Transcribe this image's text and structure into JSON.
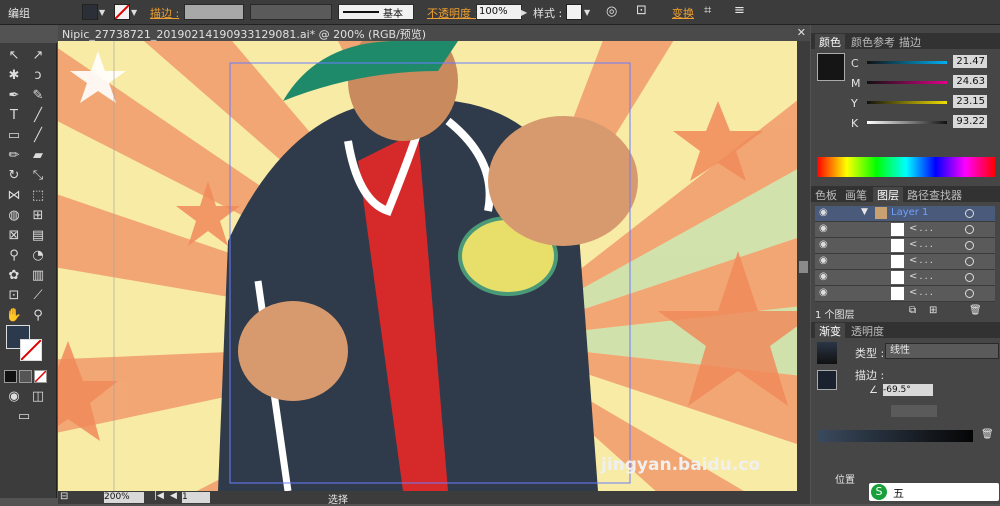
{
  "control_bar": {
    "object_type": "编组",
    "stroke_label": "描边 :",
    "brush_label": "基本",
    "opacity_label": "不透明度 :",
    "opacity_value": "100%",
    "style_label": "样式 :",
    "transform_label": "变换"
  },
  "document": {
    "tab_title": "Nipic_27738721_20190214190933129081.ai* @ 200% (RGB/预览)"
  },
  "status_bar": {
    "zoom": "200%",
    "page": "1",
    "mode": "选择"
  },
  "color_panel": {
    "tabs": [
      "颜色",
      "颜色参考",
      "描边"
    ],
    "channels": [
      {
        "name": "C",
        "value": "21.47"
      },
      {
        "name": "M",
        "value": "24.63"
      },
      {
        "name": "Y",
        "value": "23.15"
      },
      {
        "name": "K",
        "value": "93.22"
      }
    ]
  },
  "layers_panel": {
    "tabs": [
      "色板",
      "画笔",
      "图层",
      "路径查找器"
    ],
    "layer_name": "Layer 1",
    "sublayers": [
      "<...",
      "<...",
      "<...",
      "<...",
      "<..."
    ],
    "footer": "1 个图层"
  },
  "gradient_panel": {
    "tabs": [
      "渐变",
      "透明度"
    ],
    "type_label": "类型 :",
    "type_value": "线性",
    "stroke_label": "描边 :",
    "angle": "-69.5°",
    "position_label": "位置"
  },
  "watermark": {
    "text": "jingyan.baidu.co",
    "ime": "五"
  },
  "colors": {
    "ui_dark": "#3c3c3c",
    "panel": "#464646",
    "accent_orange": "#f0a030"
  }
}
